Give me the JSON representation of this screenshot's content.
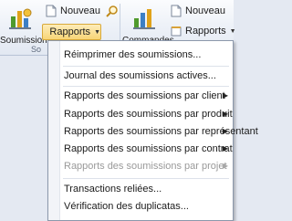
{
  "ribbon": {
    "group1": {
      "big_label": "Soumissions",
      "nouveau_label": "Nouveau",
      "rapports_label": "Rapports",
      "group_label": "So"
    },
    "group2": {
      "big_label": "Commandes",
      "nouveau_label": "Nouveau",
      "rapports_label": "Rapports"
    }
  },
  "menu": {
    "reprint": "Réimprimer des soumissions...",
    "journal": "Journal des soumissions actives...",
    "by_client": "Rapports des soumissions par client",
    "by_product": "Rapports des soumissions par produit",
    "by_rep": "Rapports des soumissions par représentant",
    "by_contract": "Rapports des soumissions par contrat",
    "by_project": "Rapports des soumissions par projet",
    "transactions": "Transactions reliées...",
    "duplicates": "Vérification des duplicatas..."
  },
  "colors": {
    "menu_highlight": "#fde8a6",
    "disabled_text": "#9a9a9a"
  }
}
